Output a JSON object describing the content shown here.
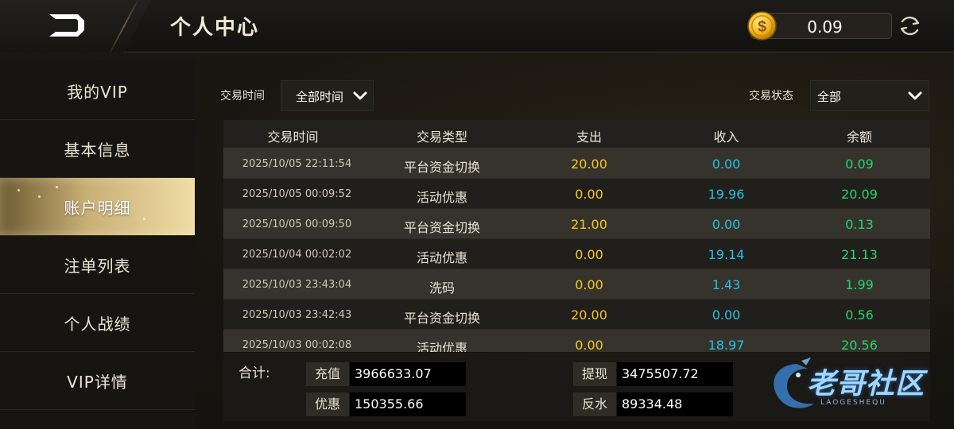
{
  "header": {
    "title": "个人中心",
    "balance": "0.09"
  },
  "sidebar": {
    "items": [
      {
        "label": "我的VIP"
      },
      {
        "label": "基本信息"
      },
      {
        "label": "账户明细",
        "active": true
      },
      {
        "label": "注单列表"
      },
      {
        "label": "个人战绩"
      },
      {
        "label": "VIP详情"
      }
    ]
  },
  "filters": {
    "time_label": "交易时间",
    "time_value": "全部时间",
    "status_label": "交易状态",
    "status_value": "全部"
  },
  "table": {
    "headers": [
      "交易时间",
      "交易类型",
      "支出",
      "收入",
      "余额"
    ],
    "rows": [
      {
        "time": "2025/10/05 22:11:54",
        "type": "平台资金切换",
        "out": "20.00",
        "in": "0.00",
        "balance": "0.09"
      },
      {
        "time": "2025/10/05 00:09:52",
        "type": "活动优惠",
        "out": "0.00",
        "in": "19.96",
        "balance": "20.09"
      },
      {
        "time": "2025/10/05 00:09:50",
        "type": "平台资金切换",
        "out": "21.00",
        "in": "0.00",
        "balance": "0.13"
      },
      {
        "time": "2025/10/04 00:02:02",
        "type": "活动优惠",
        "out": "0.00",
        "in": "19.14",
        "balance": "21.13"
      },
      {
        "time": "2025/10/03 23:43:04",
        "type": "洗码",
        "out": "0.00",
        "in": "1.43",
        "balance": "1.99"
      },
      {
        "time": "2025/10/03 23:42:43",
        "type": "平台资金切换",
        "out": "20.00",
        "in": "0.00",
        "balance": "0.56"
      },
      {
        "time": "2025/10/03 00:02:08",
        "type": "活动优惠",
        "out": "0.00",
        "in": "18.97",
        "balance": "20.56"
      }
    ]
  },
  "summary": {
    "title": "合计:",
    "recharge_label": "充值",
    "recharge_value": "3966633.07",
    "withdraw_label": "提现",
    "withdraw_value": "3475507.72",
    "discount_label": "优惠",
    "discount_value": "150355.66",
    "rebate_label": "反水",
    "rebate_value": "89334.48"
  },
  "watermark": {
    "text": "老哥社区",
    "sub": "LAOGESHEQU"
  },
  "colors": {
    "accent_gold": "#c9b077",
    "out_yellow": "#f2c81c",
    "in_cyan": "#22c2e6",
    "balance_green": "#23d670"
  },
  "icons": [
    "back-icon",
    "coin-icon",
    "refresh-icon",
    "chevron-down-icon"
  ]
}
